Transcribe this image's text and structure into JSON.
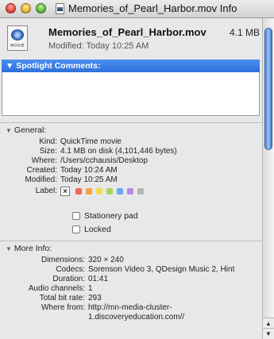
{
  "window": {
    "title": "Memories_of_Pearl_Harbor.mov Info"
  },
  "header": {
    "filename": "Memories_of_Pearl_Harbor.mov",
    "size": "4.1 MB",
    "modified": "Modified: Today 10:25 AM",
    "icon_label": "MOVIE"
  },
  "spotlight": {
    "header": "▼ Spotlight Comments:",
    "text": ""
  },
  "general": {
    "header": "General:",
    "rows": [
      {
        "label": "Kind:",
        "value": "QuickTime movie"
      },
      {
        "label": "Size:",
        "value": "4.1 MB on disk (4,101,446 bytes)"
      },
      {
        "label": "Where:",
        "value": "/Users/cchausis/Desktop"
      },
      {
        "label": "Created:",
        "value": "Today 10:24 AM"
      },
      {
        "label": "Modified:",
        "value": "Today 10:25 AM"
      }
    ],
    "label_label": "Label:",
    "label_colors": [
      "#f2645a",
      "#f5a445",
      "#f0dc4a",
      "#a4d65a",
      "#6aa6f2",
      "#b28ee0",
      "#b4b4b4"
    ],
    "stationery": "Stationery pad",
    "locked": "Locked"
  },
  "more_info": {
    "header": "More Info:",
    "rows": [
      {
        "label": "Dimensions:",
        "value": "320 × 240"
      },
      {
        "label": "Codecs:",
        "value": "Sorenson Video 3, QDesign Music 2, Hint"
      },
      {
        "label": "Duration:",
        "value": "01:41"
      },
      {
        "label": "Audio channels:",
        "value": "1"
      },
      {
        "label": "Total bit rate:",
        "value": "293"
      },
      {
        "label": "Where from:",
        "value": "http://mn-media-cluster-1.discoveryeducation.com//"
      }
    ]
  },
  "colors": {
    "selection_blue": "#2e6fdc",
    "window_bg": "#e8e8e8"
  }
}
